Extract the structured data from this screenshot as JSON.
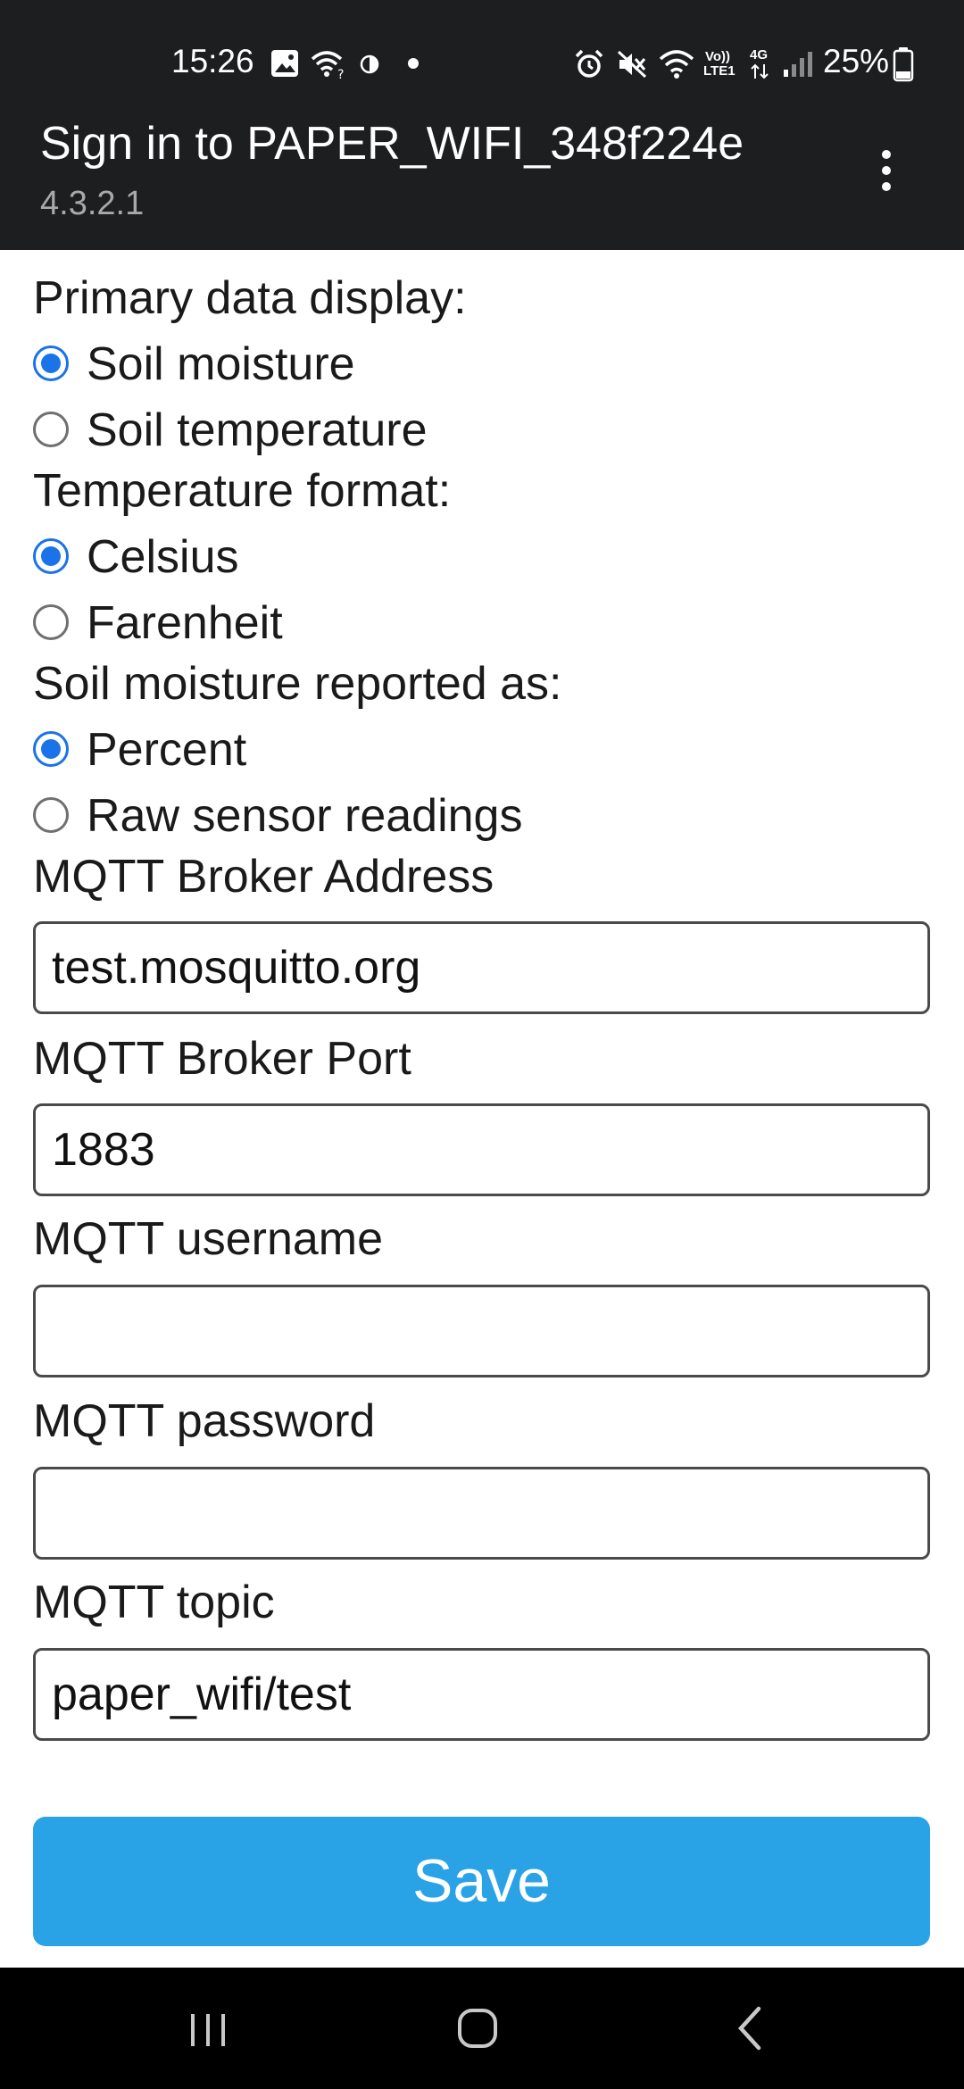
{
  "status_bar": {
    "time": "15:26",
    "battery": "25%",
    "network_volte": "Vo))",
    "network_lte": "LTE1",
    "network_4g": "4G",
    "icons": [
      "image-icon",
      "wifi-icon",
      "data-saver-icon",
      "dot-icon",
      "alarm-icon",
      "mute-icon",
      "wifi-icon",
      "volte-icon",
      "mobile-data-icon",
      "signal-icon",
      "battery-icon"
    ]
  },
  "app_bar": {
    "title": "Sign in to PAPER_WIFI_348f224e",
    "subtitle": "4.3.2.1",
    "menu_icon": "more-vert-icon"
  },
  "form": {
    "primary_display": {
      "label": "Primary data display:",
      "options": [
        {
          "label": "Soil moisture",
          "checked": true
        },
        {
          "label": "Soil temperature",
          "checked": false
        }
      ]
    },
    "temperature_format": {
      "label": "Temperature format:",
      "options": [
        {
          "label": "Celsius",
          "checked": true
        },
        {
          "label": "Farenheit",
          "checked": false
        }
      ]
    },
    "moisture_reported": {
      "label": "Soil moisture reported as:",
      "options": [
        {
          "label": "Percent",
          "checked": true
        },
        {
          "label": "Raw sensor readings",
          "checked": false
        }
      ]
    },
    "broker_address": {
      "label": "MQTT Broker Address",
      "value": "test.mosquitto.org"
    },
    "broker_port": {
      "label": "MQTT Broker Port",
      "value": "1883"
    },
    "username": {
      "label": "MQTT username",
      "value": ""
    },
    "password": {
      "label": "MQTT password",
      "value": ""
    },
    "topic": {
      "label": "MQTT topic",
      "value": "paper_wifi/test"
    },
    "save_label": "Save"
  },
  "nav_bar": {
    "icons": [
      "recents-icon",
      "home-icon",
      "back-icon"
    ]
  },
  "colors": {
    "status_bar": "#1c1e20",
    "accent_radio": "#1a73e8",
    "save_button": "#29a2e6",
    "nav_bar": "#000000"
  }
}
